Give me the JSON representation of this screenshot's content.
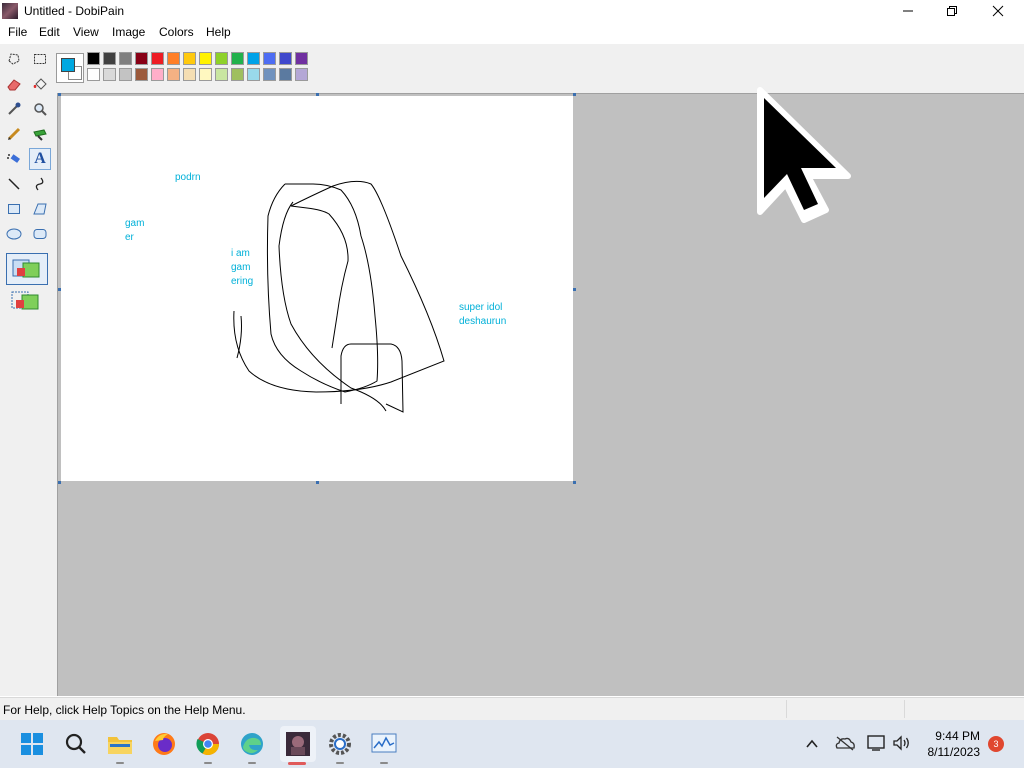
{
  "window": {
    "title": "Untitled - DobiPain",
    "controls": [
      "minimize",
      "maximize",
      "close"
    ]
  },
  "menu": [
    "File",
    "Edit",
    "View",
    "Image",
    "Colors",
    "Help"
  ],
  "toolbox": {
    "tools": [
      {
        "name": "free-form-select-icon"
      },
      {
        "name": "rect-select-icon"
      },
      {
        "name": "eraser-icon"
      },
      {
        "name": "fill-icon"
      },
      {
        "name": "color-picker-icon"
      },
      {
        "name": "magnifier-icon"
      },
      {
        "name": "pencil-icon"
      },
      {
        "name": "brush-icon"
      },
      {
        "name": "airbrush-icon"
      },
      {
        "name": "text-icon",
        "selected": true,
        "glyph": "A"
      },
      {
        "name": "line-icon"
      },
      {
        "name": "curve-icon"
      },
      {
        "name": "rectangle-icon"
      },
      {
        "name": "polygon-icon"
      },
      {
        "name": "ellipse-icon"
      },
      {
        "name": "rounded-rectangle-icon"
      }
    ],
    "options": [
      "opaque-background-option-icon",
      "transparent-background-option-icon"
    ]
  },
  "palette": {
    "foreground": "#00a8e0",
    "background": "#ffffff",
    "row1": [
      "#000000",
      "#404040",
      "#7f7f7f",
      "#880015",
      "#ed1c24",
      "#ff7f27",
      "#ffc90e",
      "#fff200",
      "#8ed12a",
      "#22b14c",
      "#00a2e8",
      "#4d6df3",
      "#3f48cc",
      "#7030a0"
    ],
    "row2": [
      "#ffffff",
      "#d9d9d9",
      "#c3c3c3",
      "#9c5a3c",
      "#ffaec9",
      "#f4b183",
      "#f5deb3",
      "#fff8c0",
      "#c9e6a0",
      "#9fbf5f",
      "#99d9ea",
      "#7092be",
      "#5b7aa0",
      "#b4a7d6"
    ]
  },
  "canvas_texts": [
    {
      "id": "podrn",
      "text": "podrn"
    },
    {
      "id": "gamer",
      "text": "gam\ner"
    },
    {
      "id": "iam",
      "text": "i am\ngam\nering"
    },
    {
      "id": "superidol",
      "text": "super idol\ndeshaurun"
    }
  ],
  "text_color": "#00b0d8",
  "status": {
    "text": "For Help, click Help Topics on the Help Menu."
  },
  "taskbar": {
    "apps": [
      "start-icon",
      "search-icon",
      "file-explorer-icon",
      "firefox-icon",
      "chrome-icon",
      "edge-icon",
      "dobipain-icon",
      "settings-icon",
      "task-manager-icon"
    ],
    "tray": [
      "chevron-up-icon",
      "onedrive-icon",
      "network-icon",
      "volume-icon"
    ],
    "time": "9:44 PM",
    "date": "8/11/2023",
    "notification_count": "3"
  }
}
